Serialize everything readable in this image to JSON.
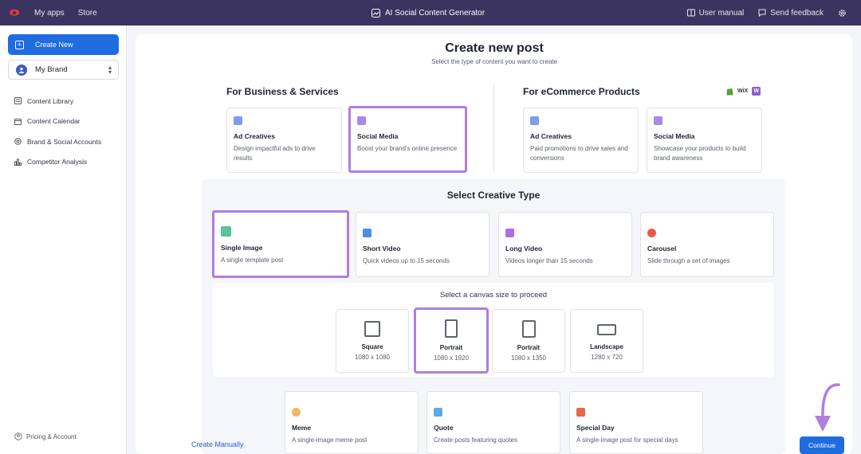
{
  "topbar": {
    "links": [
      "My apps",
      "Store"
    ],
    "app_title": "AI Social Content Generator",
    "user_manual": "User manual",
    "send_feedback": "Send feedback"
  },
  "sidebar": {
    "create_new": "Create New",
    "brand": "My Brand",
    "items": [
      {
        "label": "Content Library",
        "icon": "library-icon"
      },
      {
        "label": "Content Calendar",
        "icon": "calendar-icon"
      },
      {
        "label": "Brand & Social Accounts",
        "icon": "accounts-icon"
      },
      {
        "label": "Competitor Analysis",
        "icon": "analysis-icon"
      }
    ],
    "bottom": "Pricing & Account"
  },
  "main": {
    "title": "Create new post",
    "subtitle": "Select the type of content you want to create",
    "business": {
      "heading": "For Business & Services",
      "cards": [
        {
          "title": "Ad Creatives",
          "desc": "Design impactful ads to drive results"
        },
        {
          "title": "Social Media",
          "desc": "Boost your brand's online presence"
        }
      ]
    },
    "ecommerce": {
      "heading": "For eCommerce Products",
      "platform_badges": [
        "shopify",
        "WiX",
        "W"
      ],
      "cards": [
        {
          "title": "Ad Creatives",
          "desc": "Paid promotions to drive sales and conversions"
        },
        {
          "title": "Social Media",
          "desc": "Showcase your products to build brand awareness"
        }
      ]
    },
    "creative": {
      "heading": "Select Creative Type",
      "types": [
        {
          "title": "Single Image",
          "desc": "A single template post"
        },
        {
          "title": "Short Video",
          "desc": "Quick videos up to 15 seconds"
        },
        {
          "title": "Long Video",
          "desc": "Videos longer than 15 seconds"
        },
        {
          "title": "Carousel",
          "desc": "Slide through a set of images"
        }
      ],
      "canvas_label": "Select a canvas size to proceed",
      "sizes": [
        {
          "name": "Square",
          "dim": "1080 x 1080"
        },
        {
          "name": "Portrait",
          "dim": "1080 x 1920"
        },
        {
          "name": "Portrait",
          "dim": "1080 x 1350"
        },
        {
          "name": "Landscape",
          "dim": "1280 x 720"
        }
      ],
      "more": [
        {
          "title": "Meme",
          "desc": "A single-image meme post"
        },
        {
          "title": "Quote",
          "desc": "Create posts featuring quotes"
        },
        {
          "title": "Special Day",
          "desc": "A single-image post for special days"
        }
      ]
    },
    "create_manually": "Create Manually",
    "continue": "Continue"
  },
  "colors": {
    "topbar": "#3b3360",
    "primary": "#1f6ce0",
    "selection": "#b07de0"
  }
}
